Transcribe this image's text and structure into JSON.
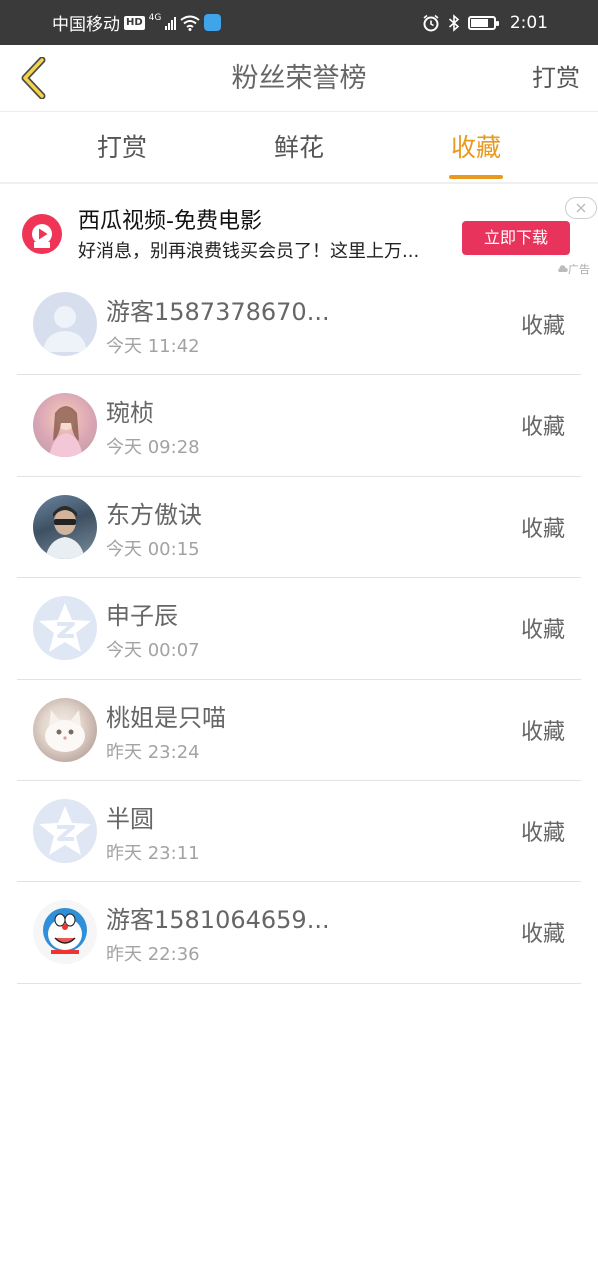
{
  "status_bar": {
    "carrier": "中国移动",
    "hd": "HD",
    "network": "4G",
    "time": "2:01"
  },
  "nav": {
    "title": "粉丝荣誉榜",
    "right_action": "打赏"
  },
  "tabs": [
    {
      "label": "打赏",
      "active": false
    },
    {
      "label": "鲜花",
      "active": false
    },
    {
      "label": "收藏",
      "active": true
    }
  ],
  "ad": {
    "title": "西瓜视频-免费电影",
    "description": "好消息，别再浪费钱买会员了！这里上万...",
    "button_label": "立即下载",
    "tag": "广告"
  },
  "list": [
    {
      "name": "游客1587378670...",
      "time": "今天 11:42",
      "action": "收藏",
      "avatar": "default"
    },
    {
      "name": "琬桢",
      "time": "今天 09:28",
      "action": "收藏",
      "avatar": "girl"
    },
    {
      "name": "东方傲诀",
      "time": "今天 00:15",
      "action": "收藏",
      "avatar": "man"
    },
    {
      "name": "申子辰",
      "time": "今天 00:07",
      "action": "收藏",
      "avatar": "q"
    },
    {
      "name": "桃姐是只喵",
      "time": "昨天 23:24",
      "action": "收藏",
      "avatar": "cat"
    },
    {
      "name": "半圆",
      "time": "昨天 23:11",
      "action": "收藏",
      "avatar": "q"
    },
    {
      "name": "游客1581064659...",
      "time": "昨天 22:36",
      "action": "收藏",
      "avatar": "dora"
    }
  ],
  "colors": {
    "accent": "#e89a1e",
    "ad_button": "#e8345d",
    "status_bar": "#3a3a3a"
  }
}
